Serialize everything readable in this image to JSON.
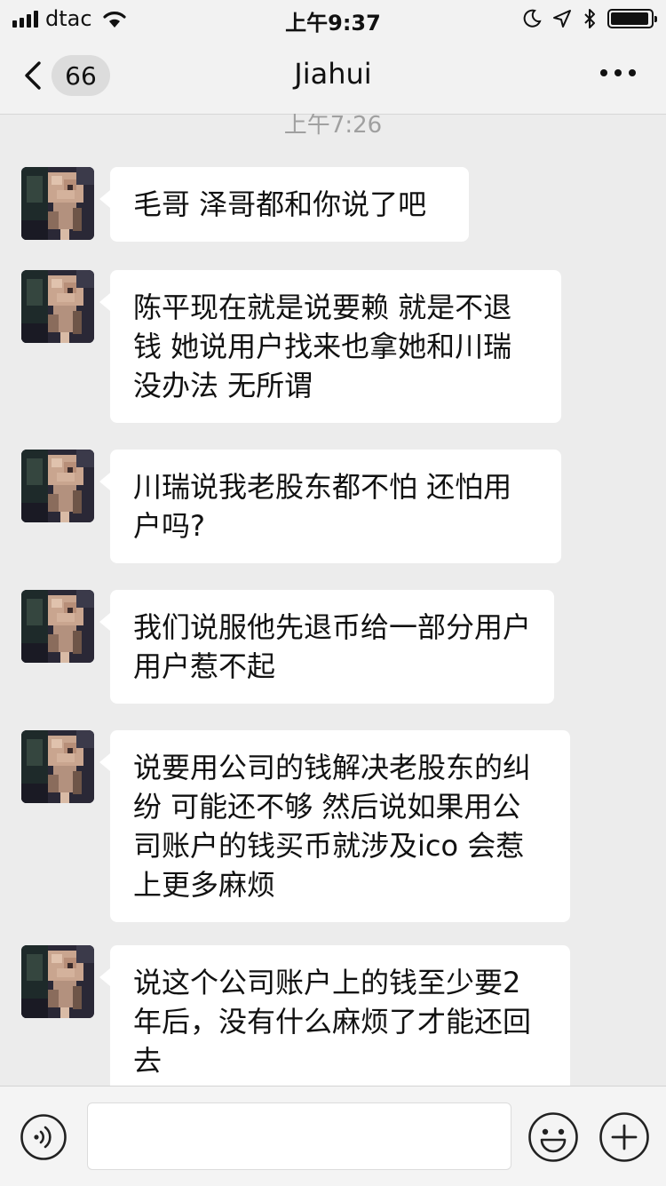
{
  "status_bar": {
    "carrier": "dtac",
    "time": "上午9:37",
    "battery_level": 0.95
  },
  "nav": {
    "back_unread_count": "66",
    "title": "Jiahui"
  },
  "chat": {
    "timestamp": "上午7:26",
    "messages": [
      {
        "sender": "Jiahui",
        "text": "毛哥 泽哥都和你说了吧"
      },
      {
        "sender": "Jiahui",
        "text": "陈平现在就是说要赖 就是不退钱 她说用户找来也拿她和川瑞没办法 无所谓"
      },
      {
        "sender": "Jiahui",
        "text": "川瑞说我老股东都不怕 还怕用户吗?"
      },
      {
        "sender": "Jiahui",
        "text": "我们说服他先退币给一部分用户 用户惹不起"
      },
      {
        "sender": "Jiahui",
        "text": "说要用公司的钱解决老股东的纠纷 可能还不够 然后说如果用公司账户的钱买币就涉及ico 会惹上更多麻烦"
      },
      {
        "sender": "Jiahui",
        "text": "说这个公司账户上的钱至少要2年后，没有什么麻烦了才能还回去"
      }
    ]
  },
  "input_bar": {
    "value": "",
    "icons": [
      "voice-icon",
      "emoji-icon",
      "plus-icon"
    ]
  },
  "colors": {
    "chat_background": "#ececec",
    "bubble_background": "#ffffff",
    "bar_background": "#f2f2f2",
    "timestamp_text": "#a0a0a0"
  }
}
